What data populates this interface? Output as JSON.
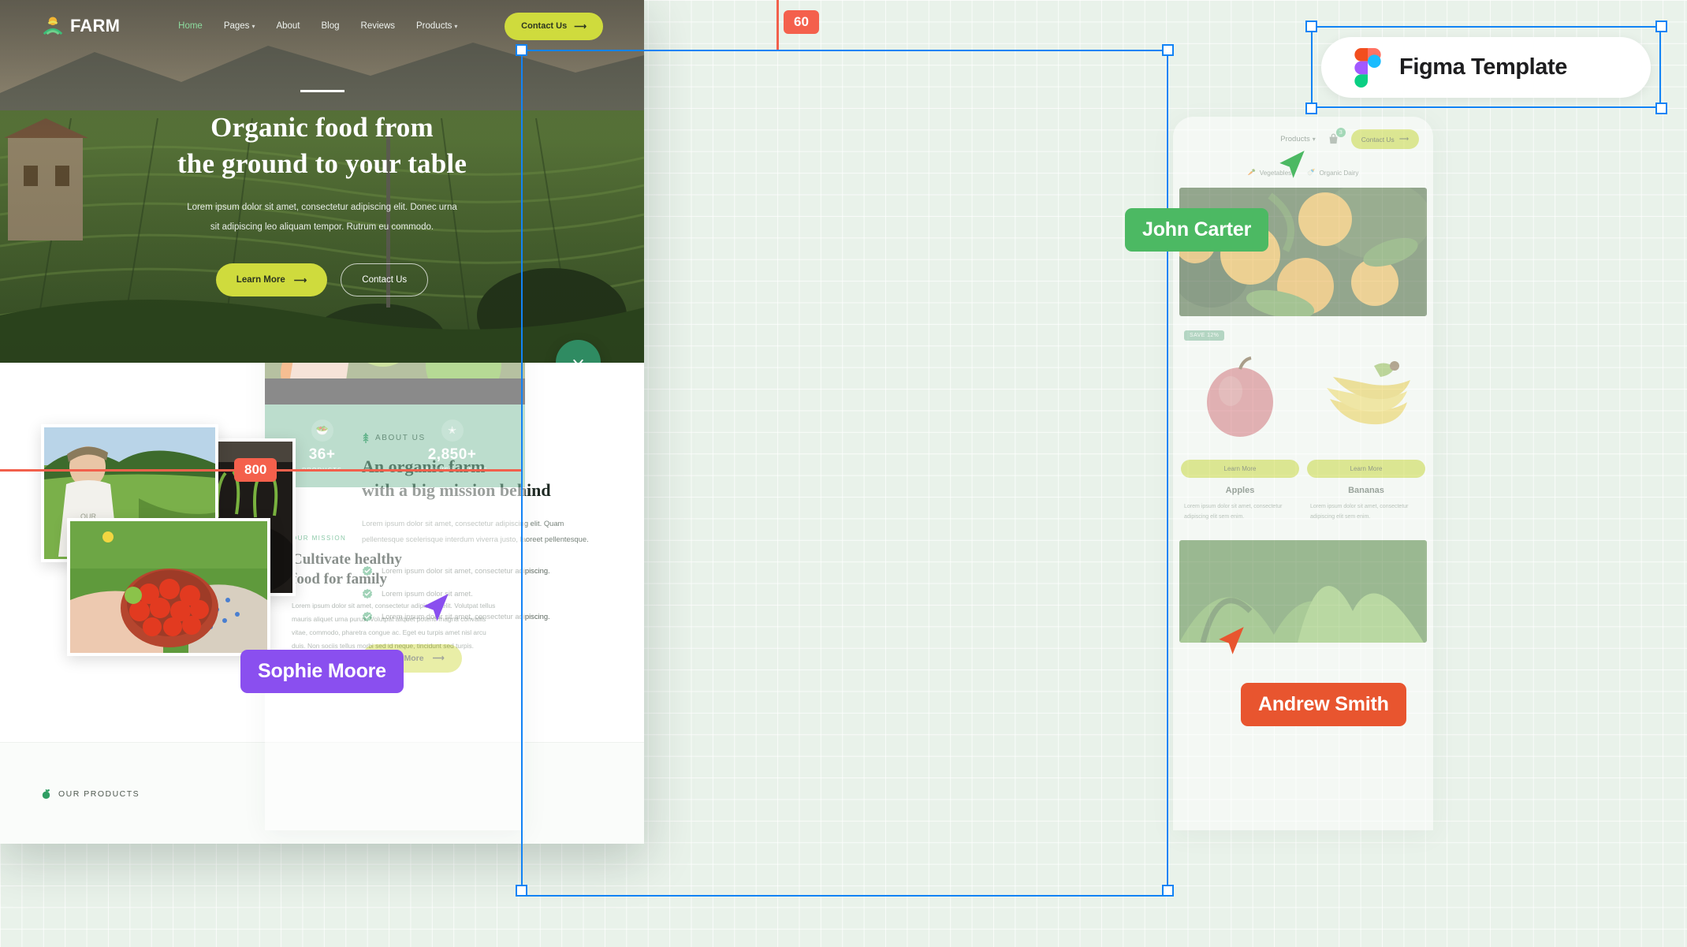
{
  "canvas": {
    "background_color": "#E9F2EA",
    "grid": "27px"
  },
  "measurements": {
    "width_badge": "60",
    "height_badge": "800",
    "guide_color": "#F4604C"
  },
  "figma_badge": {
    "label": "Figma Template",
    "icon": "figma-logo-icon"
  },
  "collaborators": [
    {
      "name": "John Carter",
      "color": "#4CB963",
      "cursor": "green"
    },
    {
      "name": "Sophie Moore",
      "color": "#8A4FEF",
      "cursor": "purple"
    },
    {
      "name": "Andrew Smith",
      "color": "#E8552F",
      "cursor": "red"
    }
  ],
  "center_card": {
    "brand": "FARM",
    "nav": [
      {
        "label": "Home",
        "active": true,
        "caret": false
      },
      {
        "label": "Pages",
        "active": false,
        "caret": true
      },
      {
        "label": "About",
        "active": false,
        "caret": false
      },
      {
        "label": "Blog",
        "active": false,
        "caret": false
      },
      {
        "label": "Reviews",
        "active": false,
        "caret": false
      },
      {
        "label": "Products",
        "active": false,
        "caret": true
      }
    ],
    "nav_cta": "Contact Us",
    "hero": {
      "title_line1": "Organic food from",
      "title_line2": "the ground to your table",
      "paragraph_line1": "Lorem ipsum dolor sit amet, consectetur adipiscing elit. Donec urna",
      "paragraph_line2": "sit adipiscing leo aliquam tempor. Rutrum eu commodo.",
      "primary_button": "Learn More",
      "secondary_button": "Contact Us",
      "scroll_icon": "chevron-down-icon"
    },
    "about": {
      "tag": "ABOUT US",
      "tag_icon": "wheat-icon",
      "heading_line1": "An organic farm",
      "heading_line2": "with a big mission behind",
      "paragraph_line1": "Lorem ipsum dolor sit amet, consectetur adipiscing elit. Quam",
      "paragraph_line2": "pellentesque scelerisque interdum viverra justo, laoreet pellentesque.",
      "bullets": [
        "Lorem ipsum dolor sit amet, consectetur adipiscing.",
        "Lorem ipsum dolor sit amet.",
        "Lorem ipsum dolor sit amet, consectetur adipiscing."
      ],
      "button": "Learn More"
    },
    "footer_tag": "OUR PRODUCTS",
    "footer_tag_icon": "apple-icon"
  },
  "left_card": {
    "brand": "FARM",
    "nav": [
      {
        "label": "Home",
        "active": true,
        "caret": false
      },
      {
        "label": "Pages",
        "active": false,
        "caret": true
      },
      {
        "label": "About",
        "active": false,
        "caret": false
      },
      {
        "label": "Blog",
        "active": false,
        "caret": false
      }
    ],
    "stats": [
      {
        "value": "36+",
        "label": "PRODUCTS",
        "icon": "basket-icon"
      },
      {
        "value": "2,850+",
        "label": "SATISFIED CLIENTS",
        "icon": "stars-icon"
      }
    ],
    "section": {
      "tag": "OUR MISSION",
      "heading_line1": "Cultivate healthy",
      "heading_line2": "food for family",
      "paragraph": "Lorem ipsum dolor sit amet, consectetur adipiscing elit. Volutpat tellus mauris aliquet urna purus. Volutpat aliquet potenti magna convallis vitae, commodo, pharetra congue ac. Eget eu turpis amet nisl arcu duis. Non sociis tellus morbi sed id neque, tincidunt sed turpis."
    }
  },
  "right_card": {
    "nav": [
      {
        "label": "Products",
        "caret": true
      }
    ],
    "cart_count": "3",
    "cart_icon": "shopping-bag-icon",
    "nav_cta": "Contact Us",
    "categories": [
      {
        "label": "Vegetables",
        "icon": "carrot-icon"
      },
      {
        "label": "Organic Dairy",
        "icon": "milk-bottle-icon"
      }
    ],
    "products": [
      {
        "name": "Apples",
        "badge": "SAVE 12%",
        "button": "Learn More",
        "desc": "Lorem ipsum dolor sit amet, consectetur adipiscing elit sem enim."
      },
      {
        "name": "Bananas",
        "badge": "",
        "button": "Learn More",
        "desc": "Lorem ipsum dolor sit amet, consectetur adipiscing elit sem enim."
      }
    ]
  }
}
